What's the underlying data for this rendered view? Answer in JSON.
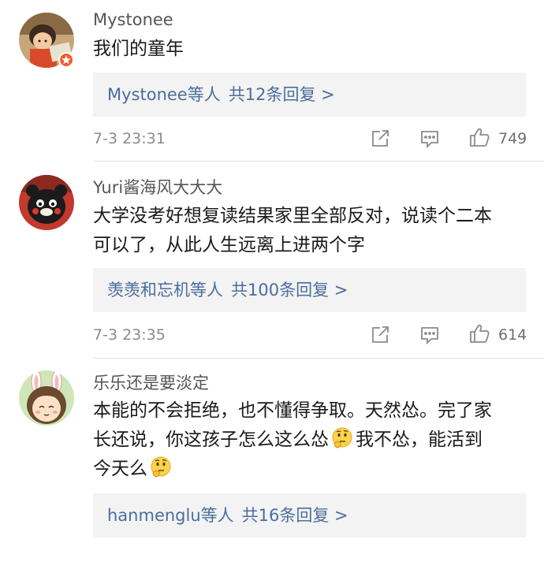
{
  "comments": [
    {
      "username": "Mystonee",
      "text_lines": [
        "我们的童年"
      ],
      "reply_names": "Mystonee",
      "reply_suffix": "等人",
      "reply_count": "共12条回复 >",
      "timestamp": "7-3 23:31",
      "likes": "749",
      "verified": true
    },
    {
      "username": "Yuri酱海风大大大",
      "text_lines": [
        "大学没考好想复读结果家里全部反对，说读个二本",
        "可以了，从此人生远离上进两个字"
      ],
      "reply_names": "羡羡和忘机",
      "reply_suffix": "等人",
      "reply_count": "共100条回复 >",
      "timestamp": "7-3 23:35",
      "likes": "614"
    },
    {
      "username": "乐乐还是要淡定",
      "text_line1": "本能的不会拒绝，也不懂得争取。天然怂。完了家",
      "text_line2a": "长还说，你这孩子怎么这么怂",
      "text_line2b": "我不怂，能活到",
      "text_line3": "今天么",
      "reply_names": "hanmenglu",
      "reply_suffix": "等人",
      "reply_count": "共16条回复 >"
    }
  ],
  "icons": {
    "share": "share-icon",
    "comment": "comment-icon",
    "like": "thumbs-up-icon",
    "emoji": "thinking-face-emoji"
  },
  "colors": {
    "link": "#4a6e9e",
    "badge": "#f15b2a",
    "reply_bg": "#f3f3f3"
  }
}
